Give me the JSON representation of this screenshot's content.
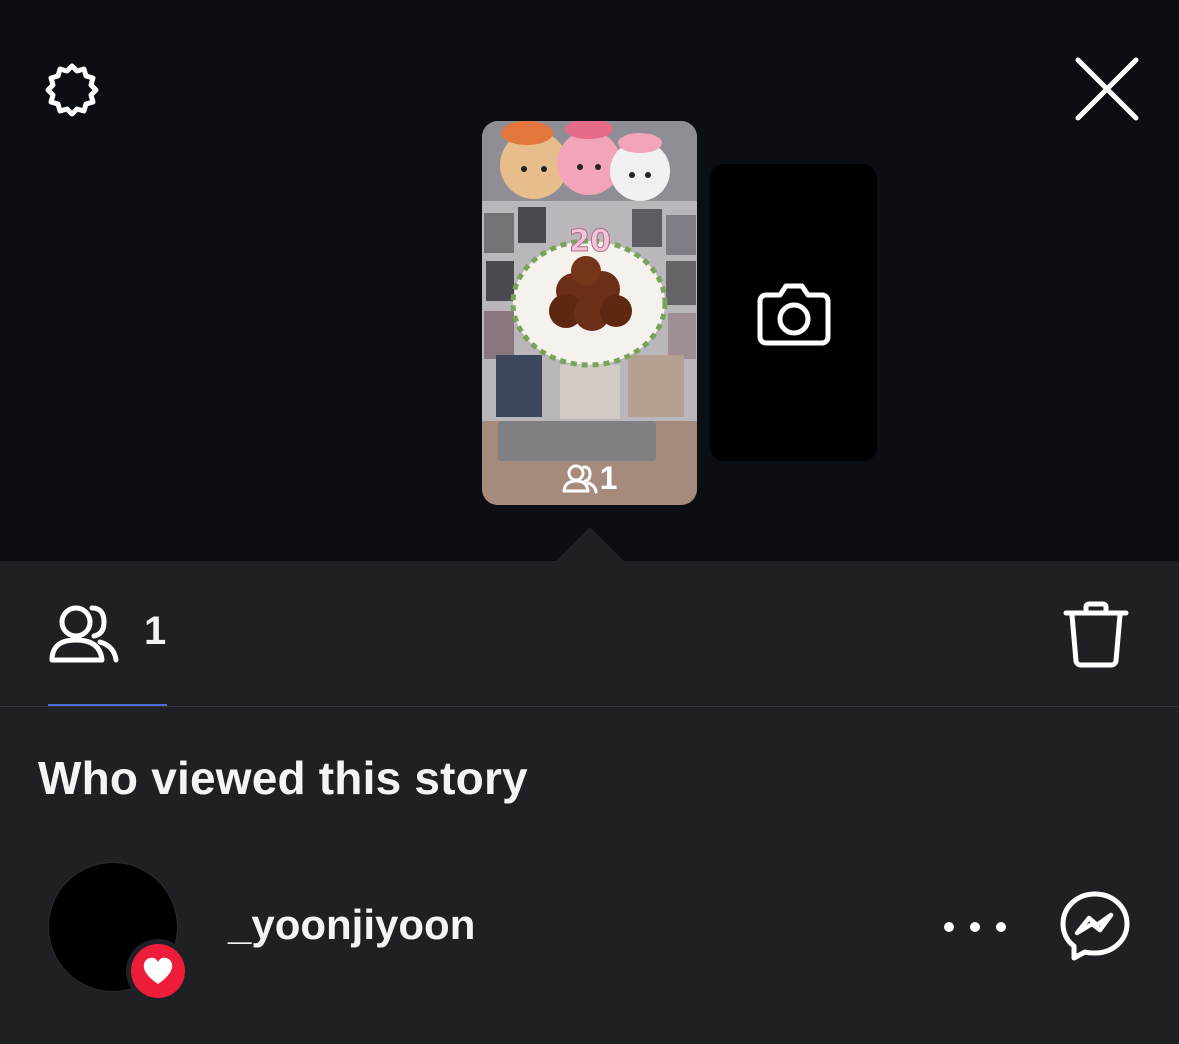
{
  "header": {
    "settings_icon": "gear-icon",
    "close_icon": "close-icon"
  },
  "story": {
    "candle_text": "20",
    "viewer_icon": "viewers-icon",
    "viewer_count": "1"
  },
  "add_story": {
    "icon": "camera-icon"
  },
  "tabs": {
    "viewers_icon": "viewers-icon",
    "viewers_count": "1",
    "delete_icon": "trash-icon"
  },
  "section_title": "Who viewed this story",
  "viewers": [
    {
      "username": "_yoonjiyoon",
      "liked": true,
      "more_icon": "more-icon",
      "message_icon": "messenger-icon"
    }
  ],
  "colors": {
    "top_background": "#0b0f14",
    "panel_background": "#1f2024",
    "tab_underline": "#4e6bd8",
    "like_red": "#ee1d3a"
  }
}
